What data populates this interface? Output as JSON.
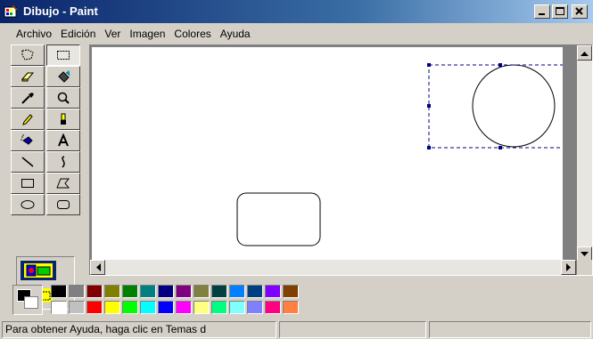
{
  "window": {
    "title": "Dibujo - Paint",
    "controls": [
      "minimize-icon",
      "maximize-icon",
      "close-icon"
    ]
  },
  "menu": {
    "items": [
      "Archivo",
      "Edición",
      "Ver",
      "Imagen",
      "Colores",
      "Ayuda"
    ]
  },
  "toolbox": {
    "tools": [
      "free-form-select-icon",
      "select-icon",
      "eraser-icon",
      "fill-icon",
      "pick-color-icon",
      "magnifier-icon",
      "pencil-icon",
      "brush-icon",
      "airbrush-icon",
      "text-icon",
      "line-icon",
      "curve-icon",
      "rectangle-icon",
      "polygon-icon",
      "ellipse-icon",
      "rounded-rectangle-icon"
    ],
    "active_tool": "select-icon",
    "options": [
      "opaque-selection-icon",
      "transparent-selection-icon"
    ]
  },
  "palette": {
    "foreground": "#000000",
    "background": "#ffffff",
    "colors": [
      "#000000",
      "#808080",
      "#800000",
      "#808000",
      "#008000",
      "#008080",
      "#000080",
      "#800080",
      "#808040",
      "#004040",
      "#0080ff",
      "#004080",
      "#8000ff",
      "#804000",
      "#ffffff",
      "#c0c0c0",
      "#ff0000",
      "#ffff00",
      "#00ff00",
      "#00ffff",
      "#0000ff",
      "#ff00ff",
      "#ffff80",
      "#00ff80",
      "#80ffff",
      "#8080ff",
      "#ff0080",
      "#ff8040"
    ]
  },
  "status": {
    "help_text": "Para obtener Ayuda, haga clic en Temas d",
    "coords": "",
    "size": ""
  }
}
